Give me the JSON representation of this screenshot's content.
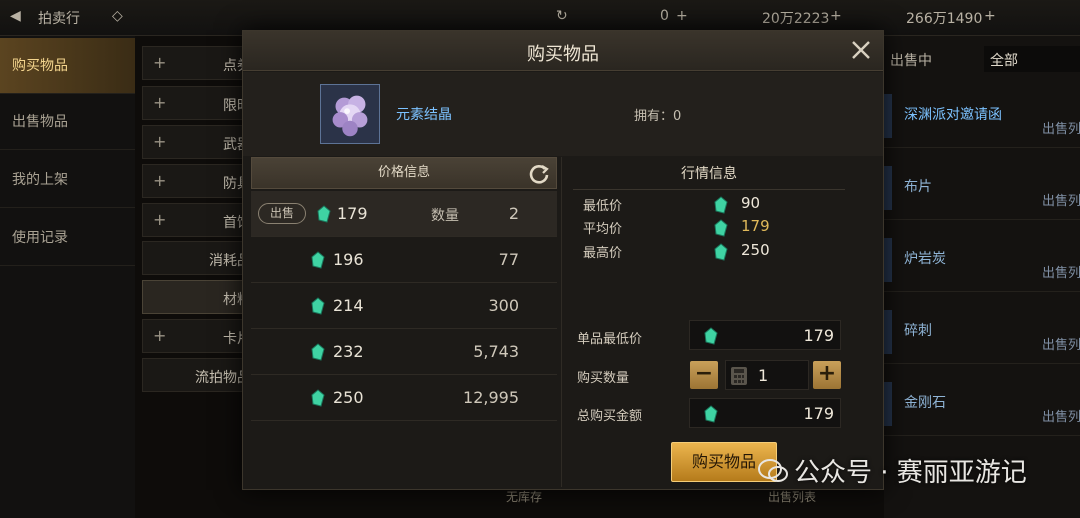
{
  "topbar": {
    "title": "拍卖行",
    "currency_1": "0",
    "currency_2": "20万2223",
    "currency_3": "266万1490"
  },
  "sidebar": {
    "items": [
      {
        "label": "购买物品",
        "active": true
      },
      {
        "label": "出售物品",
        "active": false
      },
      {
        "label": "我的上架",
        "active": false
      },
      {
        "label": "使用记录",
        "active": false
      }
    ]
  },
  "categories": {
    "items": [
      {
        "label": "点券",
        "has_plus": true
      },
      {
        "label": "限时",
        "has_plus": true
      },
      {
        "label": "武器",
        "has_plus": true
      },
      {
        "label": "防具",
        "has_plus": true
      },
      {
        "label": "首饰",
        "has_plus": true
      },
      {
        "label": "消耗品",
        "has_plus": false
      },
      {
        "label": "材料",
        "has_plus": false
      },
      {
        "label": "卡片",
        "has_plus": true
      },
      {
        "label": "流拍物品",
        "has_plus": false
      }
    ]
  },
  "right_list": {
    "filter_label": "出售中",
    "filter_value": "全部",
    "sub_label": "出售列",
    "items": [
      {
        "name": "深渊派对邀请函"
      },
      {
        "name": "布片"
      },
      {
        "name": "炉岩炭"
      },
      {
        "name": "碎刺"
      },
      {
        "name": "金刚石"
      }
    ]
  },
  "bottom": {
    "no_stock": "无库存",
    "sale_list": "出售列表"
  },
  "modal": {
    "title": "购买物品",
    "item_name": "元素结晶",
    "owned_label": "拥有：",
    "owned_value": "0",
    "price_panel_title": "价格信息",
    "sell_badge": "出售",
    "qty_label": "数量",
    "listings": [
      {
        "price": "179",
        "qty": "2"
      },
      {
        "price": "196",
        "qty": "77"
      },
      {
        "price": "214",
        "qty": "300"
      },
      {
        "price": "232",
        "qty": "5,743"
      },
      {
        "price": "250",
        "qty": "12,995"
      }
    ],
    "market": {
      "title": "行情信息",
      "min_label": "最低价",
      "min_value": "90",
      "avg_label": "平均价",
      "avg_value": "179",
      "max_label": "最高价",
      "max_value": "250"
    },
    "form": {
      "unit_min_label": "单品最低价",
      "unit_min_value": "179",
      "buy_qty_label": "购买数量",
      "buy_qty_value": "1",
      "total_label": "总购买金额",
      "total_value": "179"
    },
    "buy_button": "购买物品"
  },
  "watermark": "公众号 · 赛丽亚游记",
  "colors": {
    "accent_gold": "#e0b95a",
    "gem_green": "#3fd3a3",
    "item_name_blue": "#7cc2ff"
  }
}
